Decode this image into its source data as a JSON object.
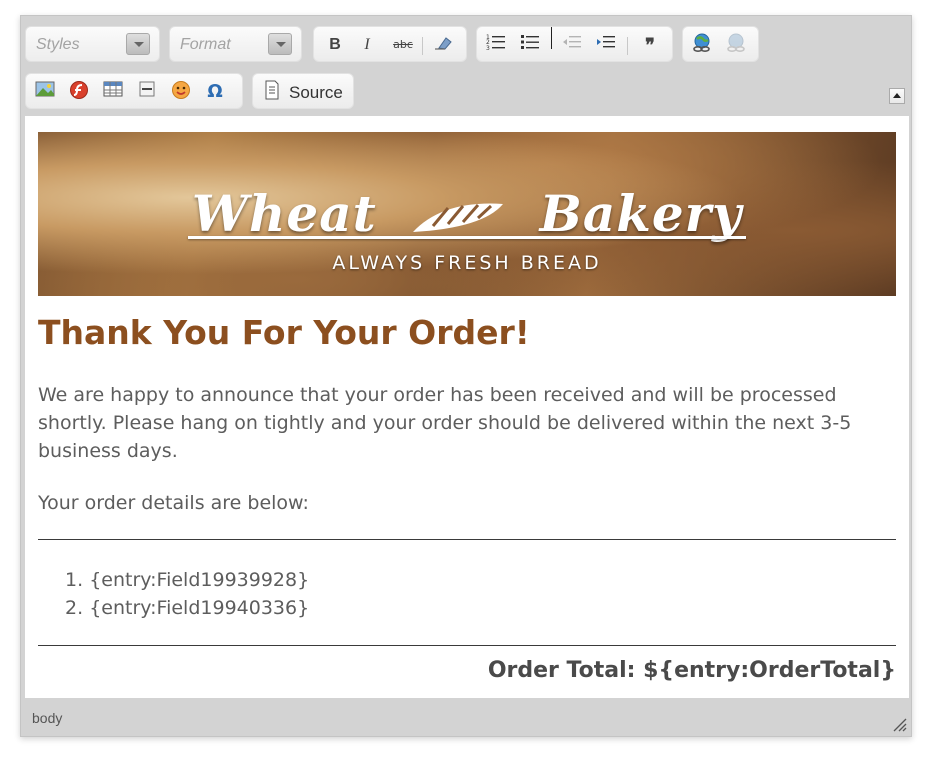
{
  "toolbar": {
    "styles_label": "Styles",
    "format_label": "Format",
    "source_label": "Source"
  },
  "content": {
    "banner_title_left": "Wheat",
    "banner_title_right": "Bakery",
    "banner_tagline": "ALWAYS FRESH BREAD",
    "heading": "Thank You For Your Order!",
    "paragraph1": "We are happy to announce that your order has been received and will be processed shortly. Please hang on tightly and your order should be delivered within the next 3-5 business days.",
    "paragraph2": "Your order details are below:",
    "items": [
      {
        "num": "1.",
        "text": "{entry:Field19939928}"
      },
      {
        "num": "2.",
        "text": "{entry:Field19940336}"
      }
    ],
    "total": "Order Total: ${entry:OrderTotal}"
  },
  "status": {
    "path": "body"
  },
  "colors": {
    "heading": "#8c4f1f",
    "body_text": "#5d5d5d",
    "chrome": "#d3d3d3"
  }
}
